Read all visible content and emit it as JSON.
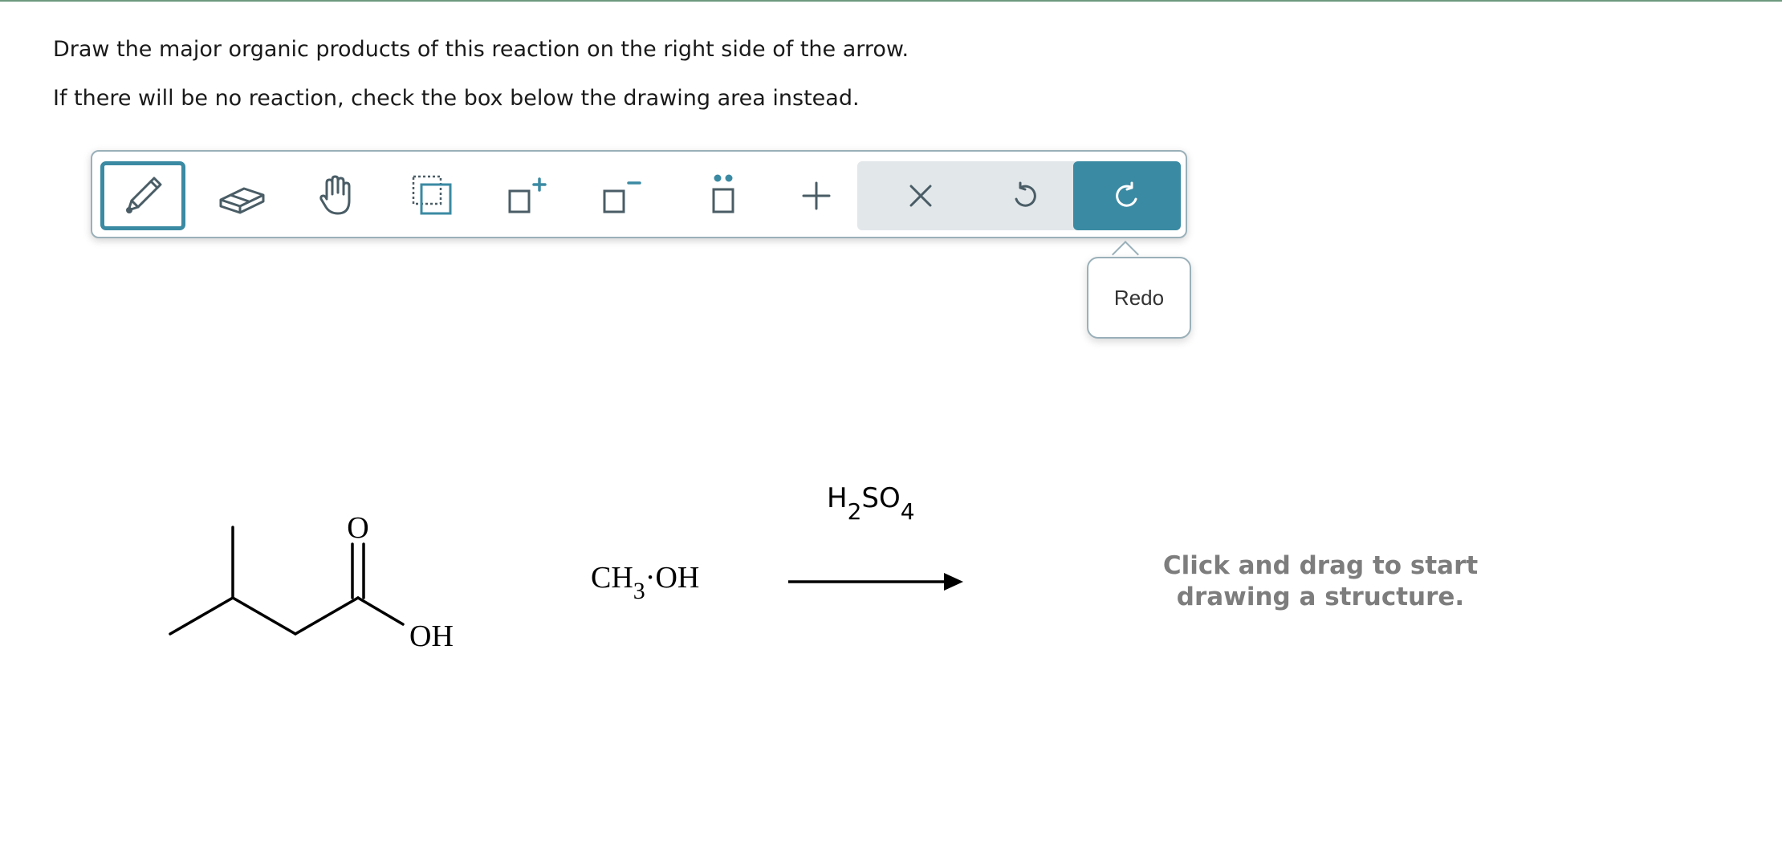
{
  "instructions": {
    "line1": "Draw the major organic products of this reaction on the right side of the arrow.",
    "line2": "If there will be no reaction, check the box below the drawing area instead."
  },
  "toolbar": {
    "tools": [
      {
        "icon": "pencil-icon",
        "active": true
      },
      {
        "icon": "eraser-icon"
      },
      {
        "icon": "hand-icon"
      },
      {
        "icon": "select-region-icon"
      },
      {
        "icon": "add-charge-icon"
      },
      {
        "icon": "remove-charge-icon"
      },
      {
        "icon": "lone-pair-icon"
      },
      {
        "icon": "plus-icon"
      },
      {
        "icon": "clear-icon"
      },
      {
        "icon": "undo-icon"
      },
      {
        "icon": "redo-icon"
      }
    ],
    "accent_color": "#3b8aa3",
    "redo_tooltip": "Redo"
  },
  "reaction": {
    "reactant1": {
      "name": "3-methylbutanoic acid",
      "carbonyl_o": "O",
      "hydroxyl": "OH"
    },
    "reactant2": {
      "part1": "CH",
      "subscript": "3",
      "part2": "·OH"
    },
    "reagent": {
      "p1": "H",
      "s1": "2",
      "p2": "SO",
      "s2": "4"
    }
  },
  "product_area": {
    "hint_line1": "Click and drag to start",
    "hint_line2": "drawing a structure."
  }
}
